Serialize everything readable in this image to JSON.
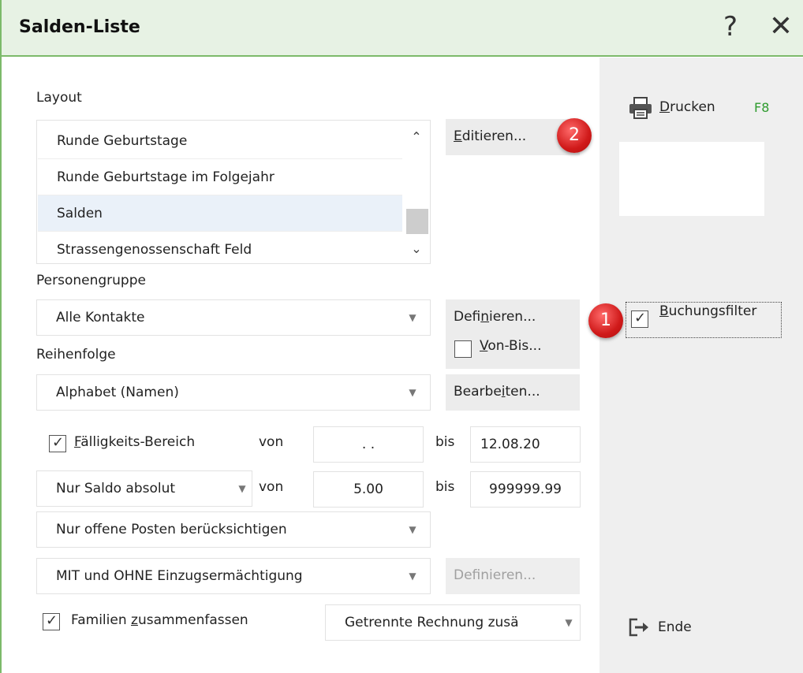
{
  "window": {
    "title": "Salden-Liste",
    "help_glyph": "?",
    "close_glyph": "✕"
  },
  "layout_section": {
    "label": "Layout",
    "items": [
      "Runde Geburtstage",
      "Runde Geburtstage im Folgejahr",
      "Salden",
      "Strassengenossenschaft Feld"
    ],
    "selected": "Salden",
    "edit_button": {
      "pre": "",
      "ul": "E",
      "post": "ditieren..."
    }
  },
  "persons_section": {
    "label": "Personengruppe",
    "value": "Alle Kontakte",
    "define_button": {
      "pre": "Defi",
      "ul": "n",
      "post": "ieren..."
    },
    "vonbis": {
      "checked": false,
      "pre": "",
      "ul": "V",
      "post": "on-Bis..."
    }
  },
  "order_section": {
    "label": "Reihenfolge",
    "value": "Alphabet (Namen)",
    "edit_button": {
      "pre": "Bearbe",
      "ul": "i",
      "post": "ten..."
    }
  },
  "due_range": {
    "checked": true,
    "label": {
      "pre": "",
      "ul": "F",
      "post": "älligkeits-Bereich"
    },
    "von_label": "von",
    "from": ". .",
    "bis_label": "bis",
    "to": "12.08.20"
  },
  "saldo_range": {
    "mode": "Nur Saldo absolut",
    "von_label": "von",
    "from": "5.00",
    "bis_label": "bis",
    "to": "999999.99"
  },
  "posten_filter": "Nur offene Posten berücksichtigen",
  "mandate_filter": "MIT und OHNE Einzugsermächtigung",
  "mandate_define_button": "Definieren...",
  "families": {
    "checked": true,
    "label": {
      "pre": "Familien ",
      "ul": "z",
      "post": "usammenfassen"
    },
    "invoice_option": "Getrennte Rechnung zusä"
  },
  "sidebar": {
    "print": {
      "ul": "D",
      "post": "rucken",
      "shortcut": "F8"
    },
    "booking_filter": {
      "checked": true,
      "ul": "B",
      "post": "uchungsfilter"
    },
    "end": {
      "label": "Ende"
    }
  },
  "callouts": {
    "one": "1",
    "two": "2"
  },
  "colors": {
    "accent_green": "#7cba6a",
    "title_bg": "#e7f2e4",
    "shortcut_green": "#2e9b2e",
    "badge_red": "#d01a1a"
  }
}
